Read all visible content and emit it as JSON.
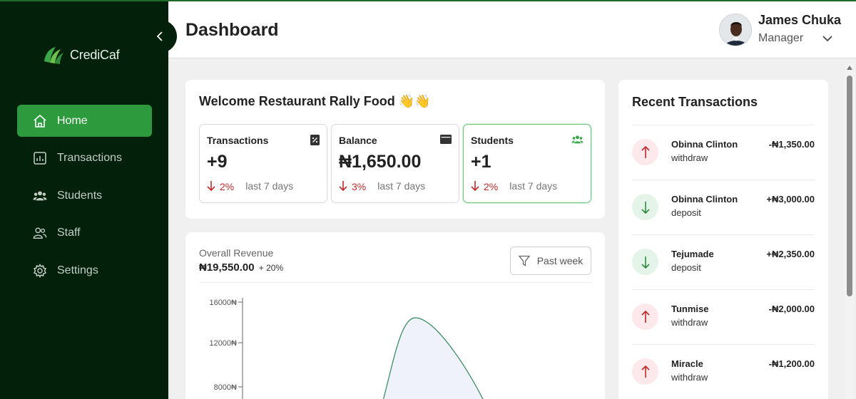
{
  "app": {
    "name": "CrediCaf",
    "brand_color": "#2d9b3d",
    "sidebar_color": "#02200a"
  },
  "sidebar": {
    "items": [
      {
        "label": "Home",
        "icon": "home-icon",
        "active": true
      },
      {
        "label": "Transactions",
        "icon": "bar-chart-icon",
        "active": false
      },
      {
        "label": "Students",
        "icon": "users-icon",
        "active": false
      },
      {
        "label": "Staff",
        "icon": "staff-icon",
        "active": false
      },
      {
        "label": "Settings",
        "icon": "gear-icon",
        "active": false
      }
    ]
  },
  "header": {
    "title": "Dashboard",
    "user_name": "James Chuka",
    "user_role": "Manager"
  },
  "welcome": {
    "title": "Welcome Restaurant Rally Food 👋👋",
    "stats": [
      {
        "label": "Transactions",
        "value": "+9",
        "change": "2%",
        "period": "last 7 days",
        "icon": "receipt-icon"
      },
      {
        "label": "Balance",
        "value": "₦1,650.00",
        "change": "3%",
        "period": "last 7 days",
        "icon": "wallet-icon"
      },
      {
        "label": "Students",
        "value": "+1",
        "change": "2%",
        "period": "last 7 days",
        "icon": "users-icon"
      }
    ]
  },
  "revenue": {
    "label": "Overall Revenue",
    "value": "₦19,550.00",
    "change": "+ 20%",
    "filter_label": "Past week"
  },
  "chart_data": {
    "type": "area",
    "y_ticks": [
      "16000₦",
      "12000₦",
      "8000₦"
    ],
    "ylim": [
      0,
      16000
    ],
    "series_color": "#2e8b57"
  },
  "transactions": {
    "title": "Recent Transactions",
    "items": [
      {
        "name": "Obinna Clinton",
        "type": "withdraw",
        "amount": "-₦1,350.00",
        "direction": "out"
      },
      {
        "name": "Obinna Clinton",
        "type": "deposit",
        "amount": "+₦3,000.00",
        "direction": "in"
      },
      {
        "name": "Tejumade",
        "type": "deposit",
        "amount": "+₦2,350.00",
        "direction": "in"
      },
      {
        "name": "Tunmise",
        "type": "withdraw",
        "amount": "-₦2,000.00",
        "direction": "out"
      },
      {
        "name": "Miracle",
        "type": "withdraw",
        "amount": "-₦1,200.00",
        "direction": "out"
      }
    ]
  }
}
